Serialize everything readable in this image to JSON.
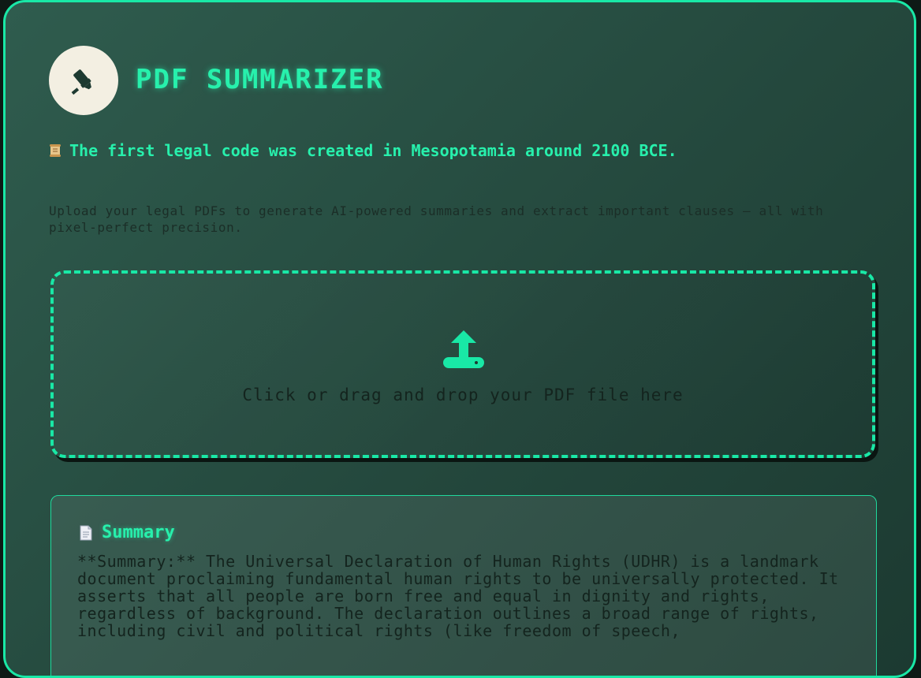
{
  "header": {
    "title": "PDF SUMMARIZER",
    "logo_icon": "highlighter-icon"
  },
  "fact": {
    "icon": "scroll-icon",
    "text": "The first legal code was created in Mesopotamia around 2100 BCE."
  },
  "intro": {
    "text": "Upload your legal PDFs to generate AI-powered summaries and extract important clauses — all with pixel-perfect precision."
  },
  "dropzone": {
    "icon": "upload-icon",
    "label": "Click or drag and drop your PDF file here"
  },
  "summary": {
    "icon": "document-icon",
    "title": "Summary",
    "body": "**Summary:** The Universal Declaration of Human Rights (UDHR) is a landmark document proclaiming fundamental human rights to be universally protected. It asserts that all people are born free and equal in dignity and rights, regardless of background. The declaration outlines a broad range of rights, including civil and political rights (like freedom of speech,"
  },
  "colors": {
    "accent": "#27f0ac",
    "border": "#19e8a6",
    "card_bg": "#2f5c4e",
    "text_dark": "#14241e",
    "logo_bg": "#f3efe2"
  }
}
